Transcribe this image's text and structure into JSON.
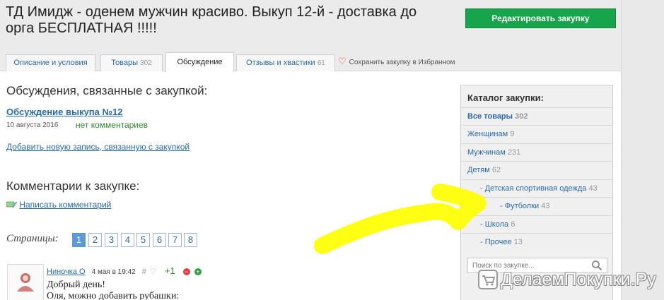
{
  "header": {
    "title_line1": "ТД Имидж - оденем мужчин красиво. Выкуп 12-й - доставка до",
    "title_line2": "орга БЕСПЛАТНАЯ !!!!!",
    "edit_button": "Редактировать закупку"
  },
  "tabs": [
    {
      "label": "Описание и условия",
      "count": ""
    },
    {
      "label": "Товары",
      "count": "302"
    },
    {
      "label": "Обсуждение",
      "count": ""
    },
    {
      "label": "Отзывы и хвастики",
      "count": "61"
    }
  ],
  "favorite_label": "Сохранить закупку в Избранном",
  "discussions": {
    "heading": "Обсуждения, связанные с закупкой:",
    "item_link": "Обсуждение выкупа №12",
    "item_date": "10 августа 2016",
    "item_comments": "нет комментариев",
    "add_link": "Добавить новую запись, связанную с закупкой"
  },
  "comments": {
    "heading": "Комментарии к закупке:",
    "write_link": "Написать комментарий"
  },
  "pager": {
    "label": "Страницы:",
    "pages": [
      "1",
      "2",
      "3",
      "4",
      "5",
      "6",
      "7",
      "8"
    ]
  },
  "comment": {
    "author": "Ниночка О",
    "date": "4 мая в 19:42",
    "hash": "#",
    "rating": "+1",
    "text_line1": "Добрый день!",
    "text_line2": "Оля, можно добавить рубашки:"
  },
  "catalog": {
    "title": "Каталог закупки:",
    "items": [
      {
        "label": "Все товары",
        "count": "302"
      },
      {
        "label": "Женщинам",
        "count": "9"
      },
      {
        "label": "Мужчинам",
        "count": "231"
      },
      {
        "label": "Детям",
        "count": "62"
      },
      {
        "label": "- Детская спортивная одежда",
        "count": "43"
      },
      {
        "label": "- Футболки",
        "count": "43"
      },
      {
        "label": "- Школа",
        "count": "6"
      },
      {
        "label": "- Прочее",
        "count": "13"
      }
    ],
    "search_placeholder": "Поиск по закупке..."
  },
  "watermark": "ДелаемПокупки.Ру",
  "colors": {
    "accent_green": "#16a54a",
    "link_blue": "#2a6aa8",
    "annotation_yellow": "#ffff00"
  },
  "icons": [
    "heart-icon",
    "pencil-comment-icon",
    "search-icon",
    "cart-logo-icon",
    "avatar-icon",
    "plus-icon",
    "minus-icon"
  ]
}
